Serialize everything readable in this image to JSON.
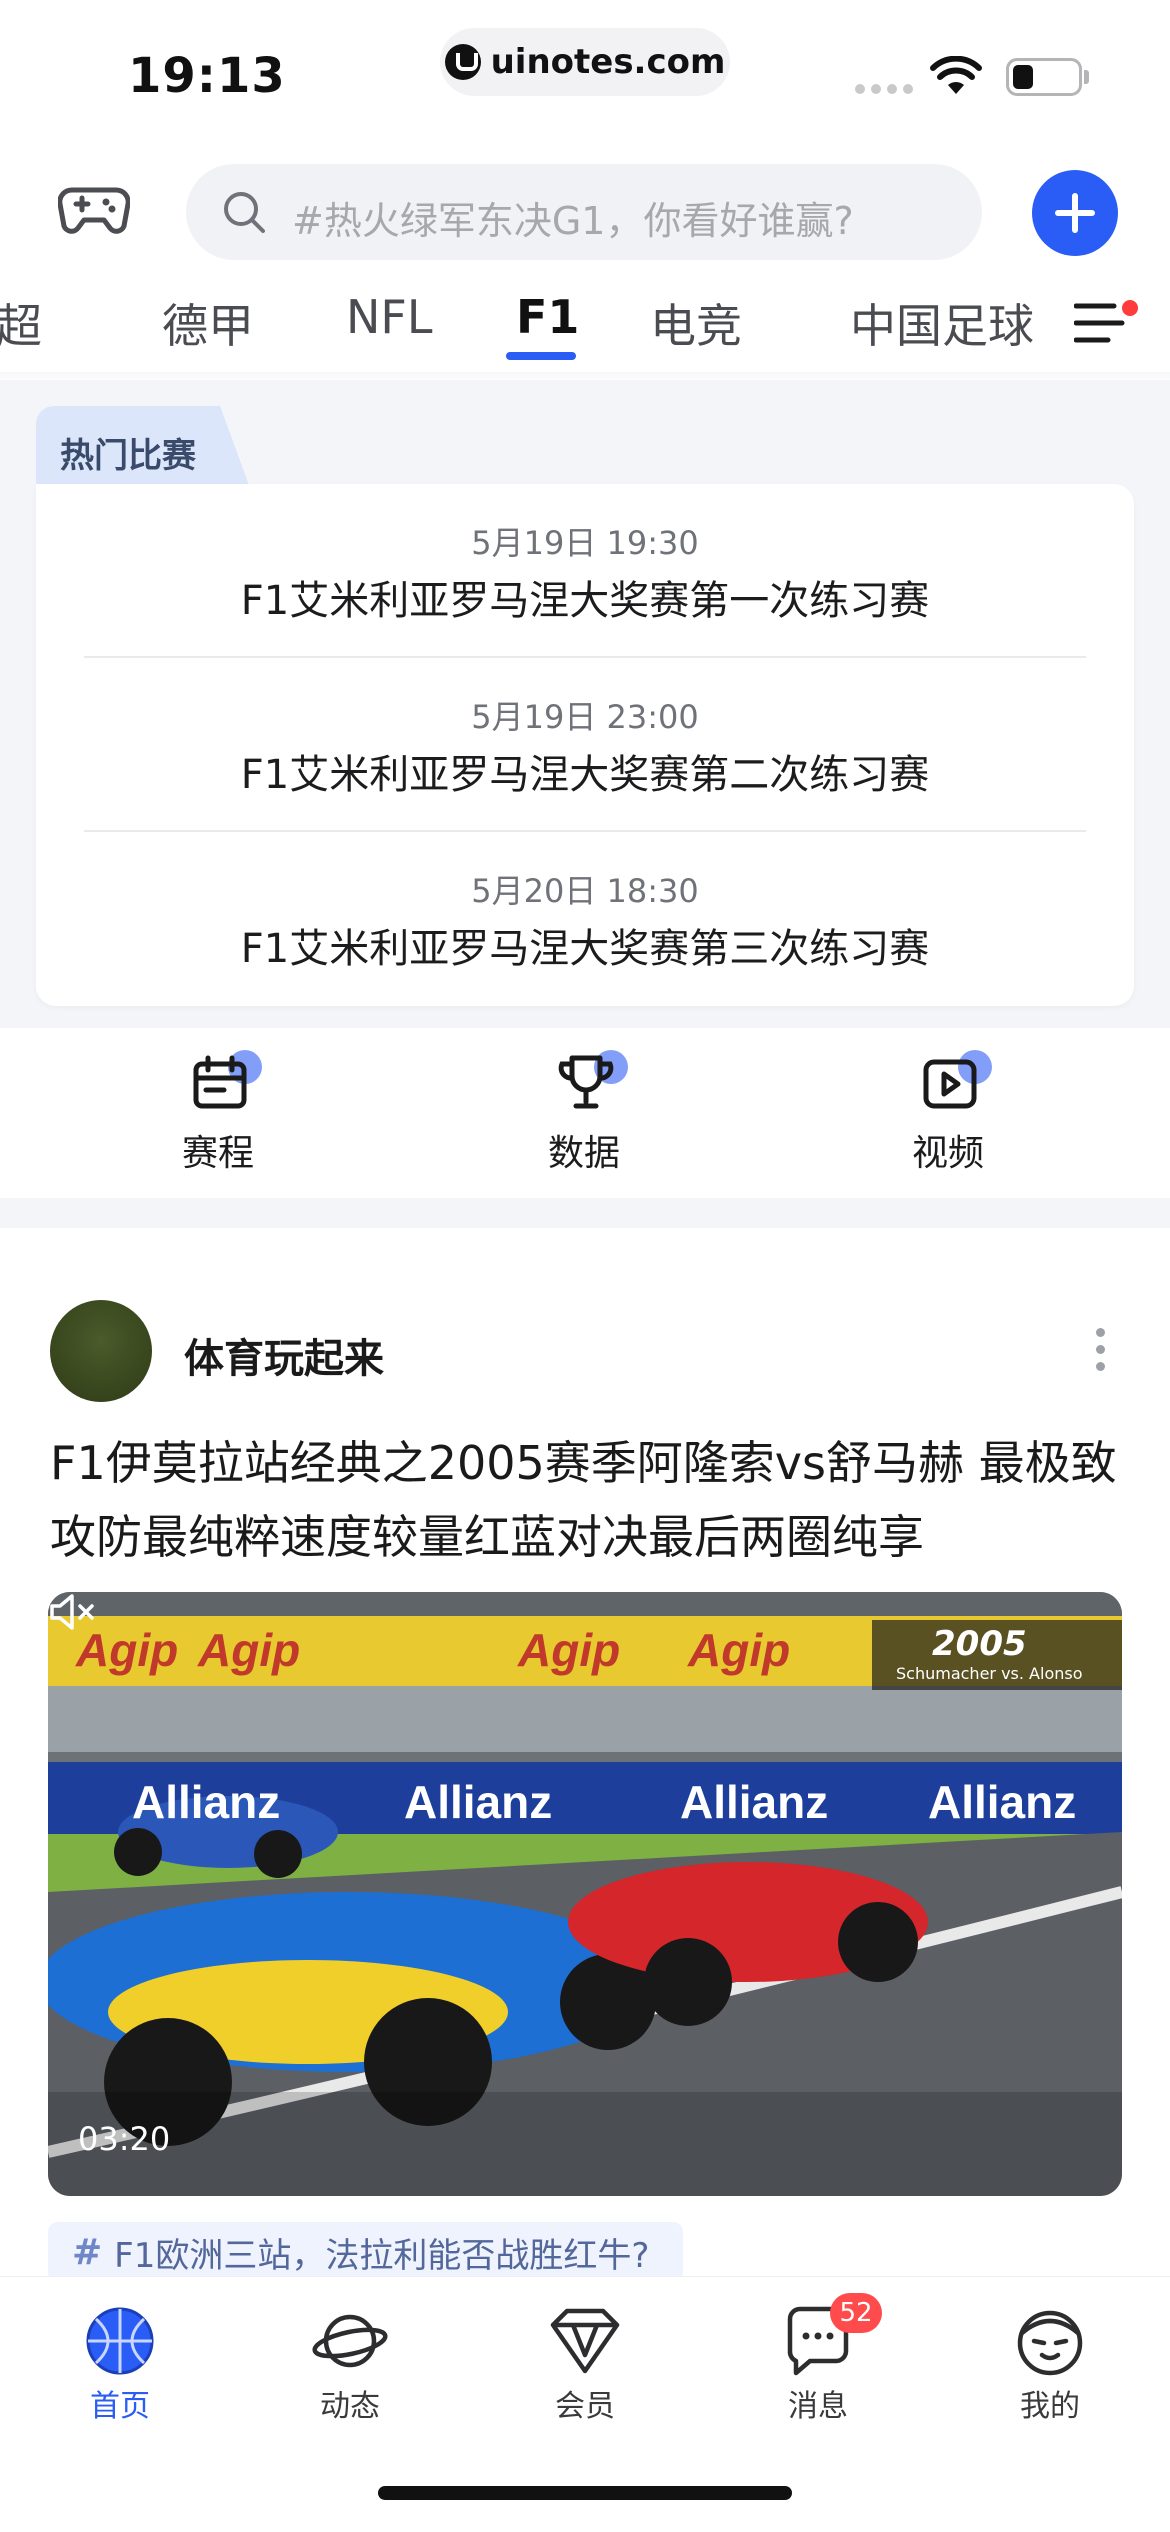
{
  "status_bar": {
    "time": "19:13",
    "url": "uinotes.com"
  },
  "header": {
    "search_placeholder": "#热火绿军东决G1，你看好谁赢?",
    "tabs": [
      {
        "label": "超",
        "active": false
      },
      {
        "label": "德甲",
        "active": false
      },
      {
        "label": "NFL",
        "active": false
      },
      {
        "label": "F1",
        "active": true
      },
      {
        "label": "电竞",
        "active": false
      },
      {
        "label": "中国足球",
        "active": false
      }
    ]
  },
  "hot_matches": {
    "section_label": "热门比赛",
    "matches": [
      {
        "time": "5月19日 19:30",
        "title": "F1艾米利亚罗马涅大奖赛第一次练习赛"
      },
      {
        "time": "5月19日 23:00",
        "title": "F1艾米利亚罗马涅大奖赛第二次练习赛"
      },
      {
        "time": "5月20日 18:30",
        "title": "F1艾米利亚罗马涅大奖赛第三次练习赛"
      }
    ]
  },
  "quick_links": [
    {
      "label": "赛程",
      "icon": "calendar-icon"
    },
    {
      "label": "数据",
      "icon": "trophy-icon"
    },
    {
      "label": "视频",
      "icon": "video-play-icon"
    }
  ],
  "post": {
    "author": "体育玩起来",
    "title": "F1伊莫拉站经典之2005赛季阿隆索vs舒马赫 最极致攻防最纯粹速度较量红蓝对决最后两圈纯享",
    "video": {
      "duration": "03:20",
      "badge_year": "2005",
      "badge_subtitle": "Schumacher vs. Alonso",
      "banner_text": "Allianz",
      "sponsor_text": "Agip"
    },
    "topic_tag": "F1欧洲三站，法拉利能否战胜红牛?"
  },
  "bottom_nav": [
    {
      "label": "首页",
      "active": true,
      "icon": "basketball-icon"
    },
    {
      "label": "动态",
      "active": false,
      "icon": "planet-icon"
    },
    {
      "label": "会员",
      "active": false,
      "icon": "diamond-icon"
    },
    {
      "label": "消息",
      "active": false,
      "icon": "chat-bubble-icon",
      "badge": "52"
    },
    {
      "label": "我的",
      "active": false,
      "icon": "profile-face-icon"
    }
  ],
  "colors": {
    "accent": "#2a5cf6",
    "badge": "#ff4b4b"
  }
}
